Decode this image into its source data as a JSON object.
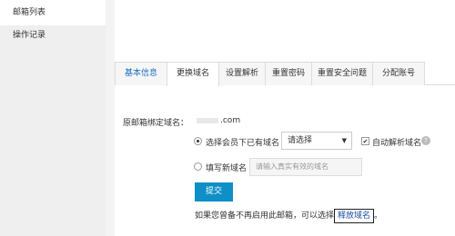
{
  "sidebar": {
    "items": [
      {
        "label": "邮箱列表"
      },
      {
        "label": "操作记录"
      }
    ]
  },
  "tabs": [
    {
      "label": "基本信息"
    },
    {
      "label": "更换域名"
    },
    {
      "label": "设置解析"
    },
    {
      "label": "重置密码"
    },
    {
      "label": "重置安全问题"
    },
    {
      "label": "分配账号"
    }
  ],
  "form": {
    "original_label": "原邮箱绑定域名：",
    "original_domain_suffix": ".com",
    "option1_label": "选择会员下已有域名",
    "select_value": "请选择",
    "auto_resolve_label": "自动解析域名",
    "option2_label": "填写新域名",
    "new_domain_placeholder": "请输入真实有效的域名",
    "submit_label": "提交",
    "note_text": "如果您曾备不再启用此邮箱，可以选择",
    "release_link": "释放域名"
  }
}
